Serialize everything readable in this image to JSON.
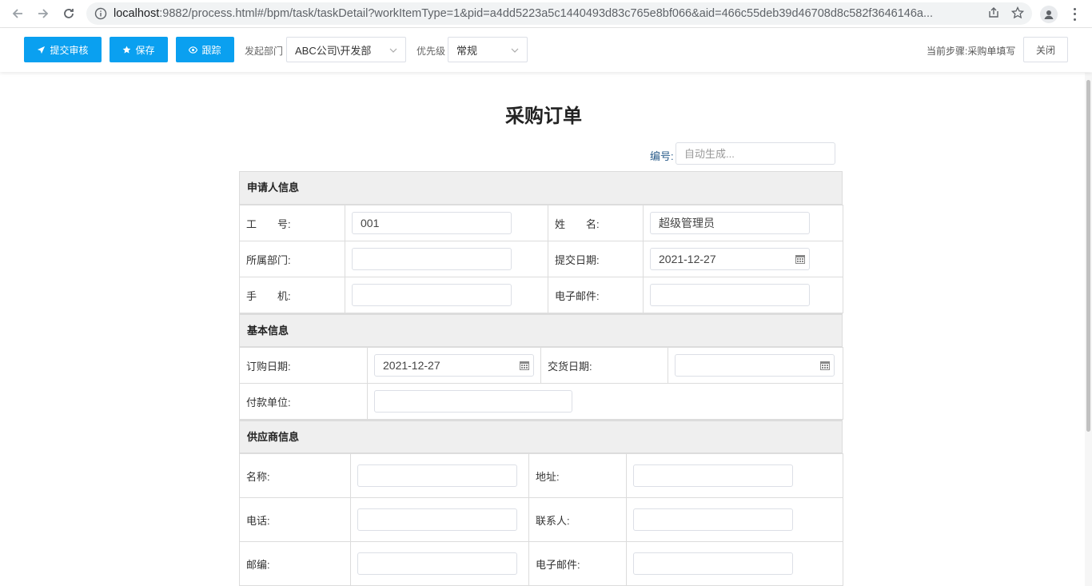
{
  "browser": {
    "url_host": "localhost",
    "url_rest": ":9882/process.html#/bpm/task/taskDetail?workItemType=1&pid=a4dd5223a5c1440493d83c765e8bf066&aid=466c55deb39d46708d8c582f3646146a..."
  },
  "toolbar": {
    "submit_label": "提交审核",
    "save_label": "保存",
    "track_label": "跟踪",
    "dept_label": "发起部门",
    "dept_value": "ABC公司\\开发部",
    "priority_label": "优先级",
    "priority_value": "常规",
    "current_step": "当前步骤:采购单填写",
    "close_label": "关闭"
  },
  "form": {
    "title": "采购订单",
    "code_label": "编号:",
    "code_placeholder": "自动生成...",
    "sections": {
      "applicant": {
        "title": "申请人信息",
        "emp_no_label": "工　　号:",
        "emp_no_value": "001",
        "name_label": "姓　　名:",
        "name_value": "超级管理员",
        "dept_label": "所属部门:",
        "dept_value": "",
        "submit_date_label": "提交日期:",
        "submit_date_value": "2021-12-27",
        "phone_label": "手　　机:",
        "phone_value": "",
        "email_label": "电子邮件:",
        "email_value": ""
      },
      "basic": {
        "title": "基本信息",
        "order_date_label": "订购日期:",
        "order_date_value": "2021-12-27",
        "delivery_date_label": "交货日期:",
        "delivery_date_value": "",
        "payer_label": "付款单位:",
        "payer_value": ""
      },
      "supplier": {
        "title": "供应商信息",
        "name_label": "名称:",
        "address_label": "地址:",
        "tel_label": "电话:",
        "contact_label": "联系人:",
        "zip_label": "邮编:",
        "email_label": "电子邮件:"
      }
    }
  },
  "colors": {
    "primary": "#0aa0f0",
    "section_bg": "#efefef",
    "border": "#dcdcdc"
  }
}
